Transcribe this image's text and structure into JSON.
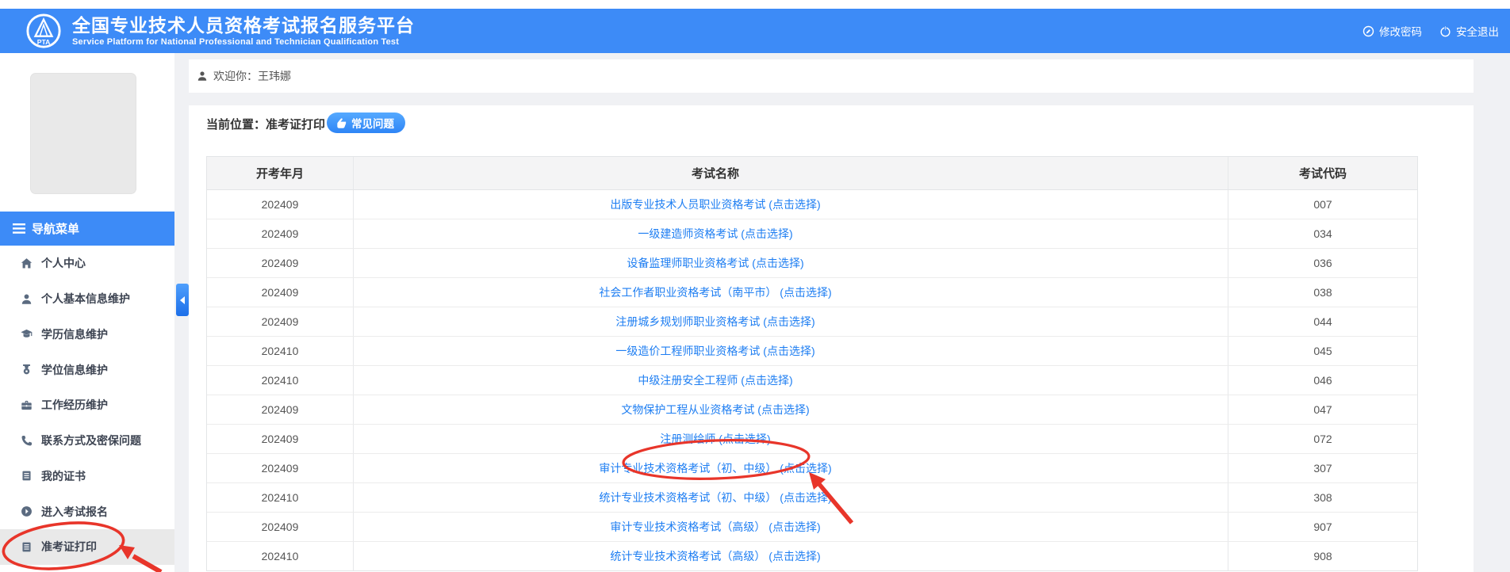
{
  "header": {
    "title": "全国专业技术人员资格考试报名服务平台",
    "subtitle": "Service Platform for National Professional and Technician Qualification Test",
    "logo_text": "PTA",
    "change_password": "修改密码",
    "logout": "安全退出"
  },
  "sidebar": {
    "nav_title": "导航菜单",
    "items": [
      {
        "label": "个人中心",
        "icon": "home-icon"
      },
      {
        "label": "个人基本信息维护",
        "icon": "user-icon"
      },
      {
        "label": "学历信息维护",
        "icon": "graduation-cap-icon"
      },
      {
        "label": "学位信息维护",
        "icon": "degree-medal-icon"
      },
      {
        "label": "工作经历维护",
        "icon": "briefcase-icon"
      },
      {
        "label": "联系方式及密保问题",
        "icon": "phone-icon"
      },
      {
        "label": "我的证书",
        "icon": "certificate-icon"
      },
      {
        "label": "进入考试报名",
        "icon": "enter-arrow-icon"
      },
      {
        "label": "准考证打印",
        "icon": "ticket-print-icon",
        "active": true
      }
    ]
  },
  "main": {
    "welcome": "欢迎你：王玮娜",
    "breadcrumb": "当前位置：准考证打印",
    "faq_button": "常见问题",
    "table": {
      "headers": [
        "开考年月",
        "考试名称",
        "考试代码"
      ],
      "rows": [
        {
          "month": "202409",
          "name": "出版专业技术人员职业资格考试 (点击选择)",
          "code": "007"
        },
        {
          "month": "202409",
          "name": "一级建造师资格考试 (点击选择)",
          "code": "034"
        },
        {
          "month": "202409",
          "name": "设备监理师职业资格考试 (点击选择)",
          "code": "036"
        },
        {
          "month": "202409",
          "name": "社会工作者职业资格考试（南平市） (点击选择)",
          "code": "038"
        },
        {
          "month": "202409",
          "name": "注册城乡规划师职业资格考试 (点击选择)",
          "code": "044"
        },
        {
          "month": "202410",
          "name": "一级造价工程师职业资格考试 (点击选择)",
          "code": "045"
        },
        {
          "month": "202410",
          "name": "中级注册安全工程师 (点击选择)",
          "code": "046"
        },
        {
          "month": "202409",
          "name": "文物保护工程从业资格考试 (点击选择)",
          "code": "047"
        },
        {
          "month": "202409",
          "name": "注册测绘师 (点击选择)",
          "code": "072"
        },
        {
          "month": "202409",
          "name": "审计专业技术资格考试（初、中级） (点击选择)",
          "code": "307",
          "annotated": true
        },
        {
          "month": "202410",
          "name": "统计专业技术资格考试（初、中级） (点击选择)",
          "code": "308"
        },
        {
          "month": "202409",
          "name": "审计专业技术资格考试（高级） (点击选择)",
          "code": "907"
        },
        {
          "month": "202410",
          "name": "统计专业技术资格考试（高级） (点击选择)",
          "code": "908"
        }
      ]
    }
  },
  "colors": {
    "header_blue": "#3d8bf7",
    "link_blue": "#1e7ef2",
    "annotation_red": "#e8352a",
    "active_item_gray": "#e9e9e9"
  }
}
